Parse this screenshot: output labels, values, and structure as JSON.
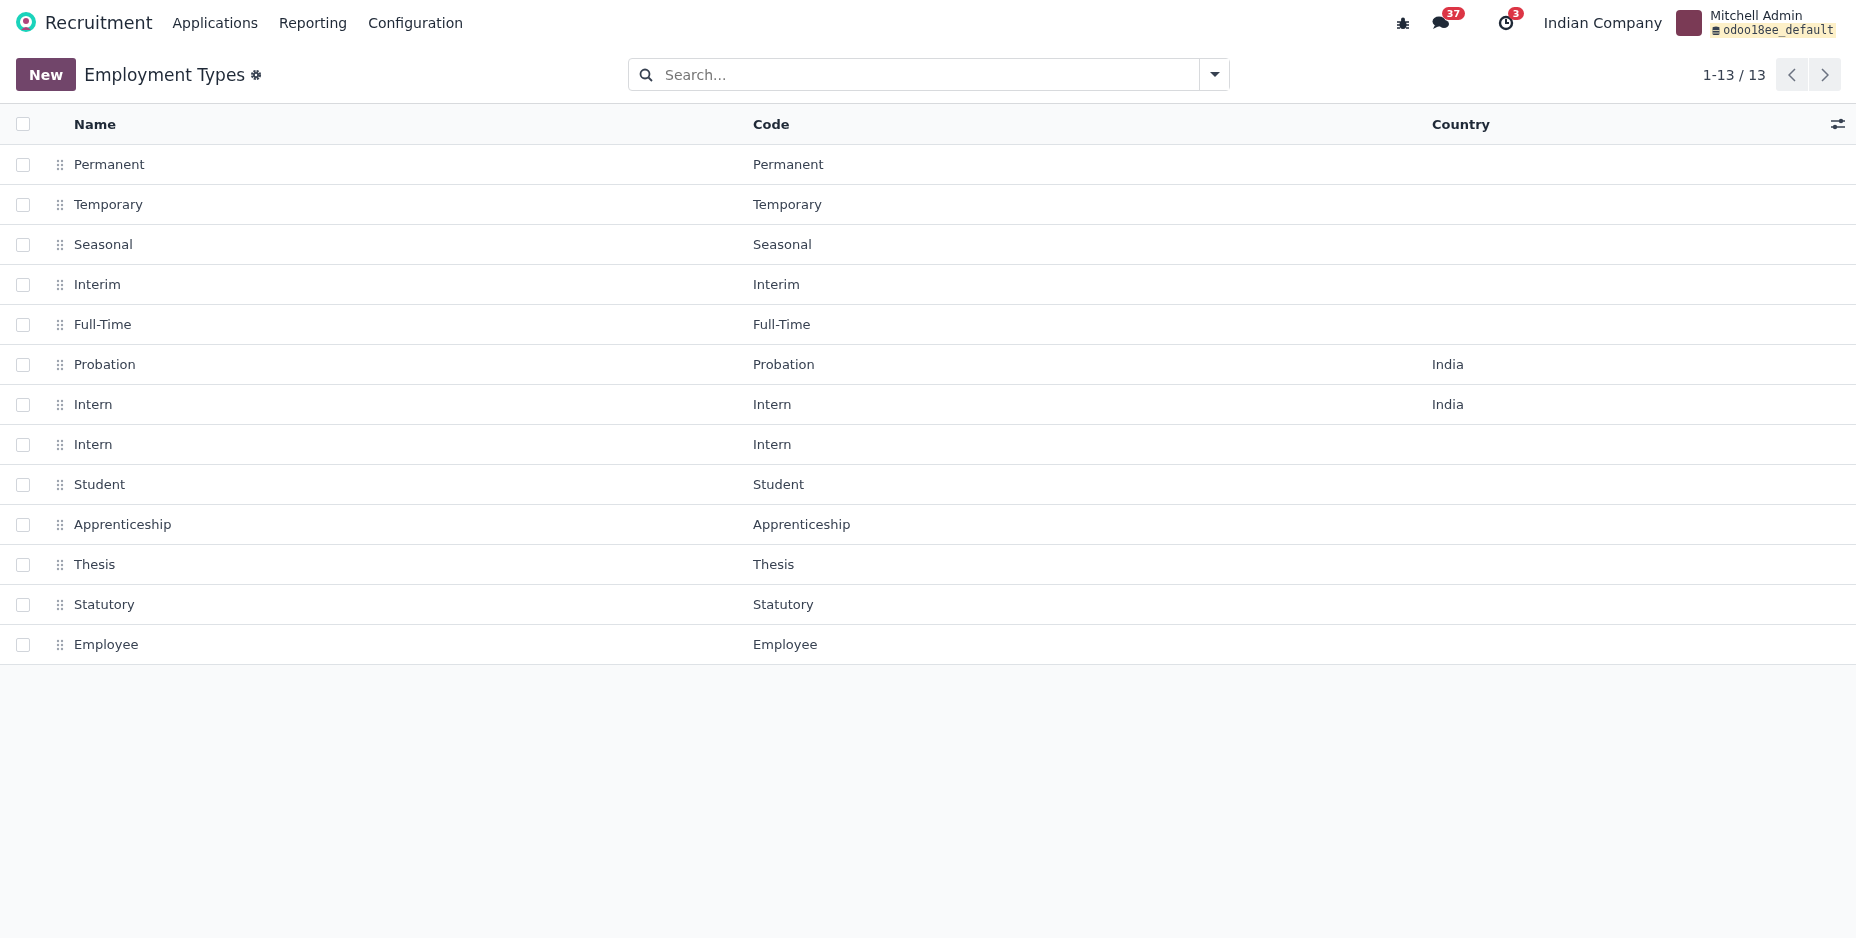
{
  "navbar": {
    "app_name": "Recruitment",
    "menu": [
      "Applications",
      "Reporting",
      "Configuration"
    ],
    "messages_badge": "37",
    "activities_badge": "3",
    "company": "Indian Company",
    "user_name": "Mitchell Admin",
    "database": "odoo18ee_default"
  },
  "control_panel": {
    "new_button": "New",
    "title": "Employment Types",
    "search": {
      "placeholder": "Search..."
    },
    "pager": "1-13 / 13"
  },
  "table": {
    "select_all_checked": false,
    "columns": [
      "Name",
      "Code",
      "Country"
    ],
    "rows": [
      {
        "name": "Permanent",
        "code": "Permanent",
        "country": "",
        "checked": false
      },
      {
        "name": "Temporary",
        "code": "Temporary",
        "country": "",
        "checked": false
      },
      {
        "name": "Seasonal",
        "code": "Seasonal",
        "country": "",
        "checked": false
      },
      {
        "name": "Interim",
        "code": "Interim",
        "country": "",
        "checked": false
      },
      {
        "name": "Full-Time",
        "code": "Full-Time",
        "country": "",
        "checked": false
      },
      {
        "name": "Probation",
        "code": "Probation",
        "country": "India",
        "checked": false
      },
      {
        "name": "Intern",
        "code": "Intern",
        "country": "India",
        "checked": false
      },
      {
        "name": "Intern",
        "code": "Intern",
        "country": "",
        "checked": false
      },
      {
        "name": "Student",
        "code": "Student",
        "country": "",
        "checked": false
      },
      {
        "name": "Apprenticeship",
        "code": "Apprenticeship",
        "country": "",
        "checked": false
      },
      {
        "name": "Thesis",
        "code": "Thesis",
        "country": "",
        "checked": false
      },
      {
        "name": "Statutory",
        "code": "Statutory",
        "country": "",
        "checked": false
      },
      {
        "name": "Employee",
        "code": "Employee",
        "country": "",
        "checked": false
      }
    ]
  }
}
